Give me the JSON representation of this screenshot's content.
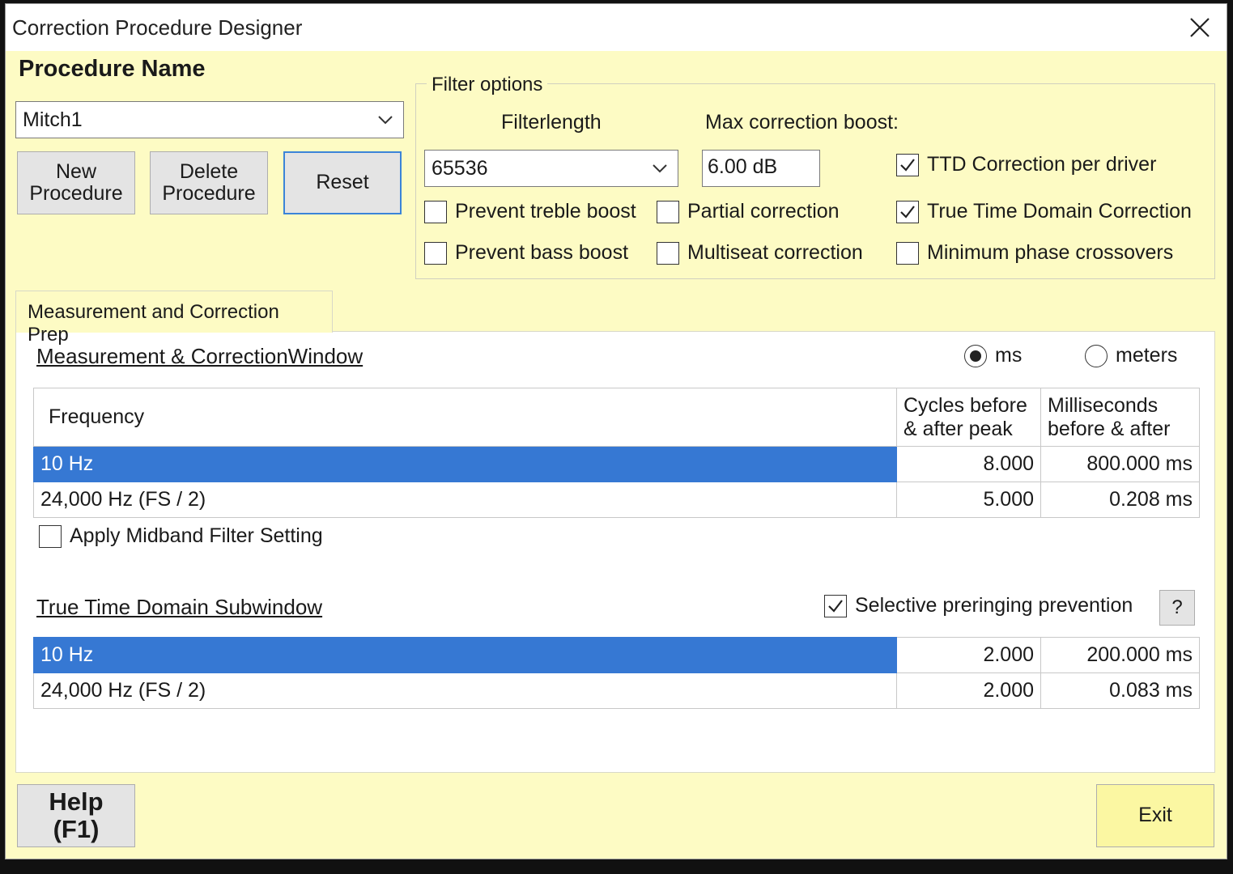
{
  "window": {
    "title": "Correction Procedure Designer",
    "colors": {
      "background": "#fdfbc4",
      "selection": "#3678d3",
      "focus_border": "#3b84d8"
    }
  },
  "procedure": {
    "label": "Procedure Name",
    "selected": "Mitch1",
    "buttons": {
      "new": "New Procedure",
      "delete": "Delete Procedure",
      "reset": "Reset"
    }
  },
  "filter_options": {
    "legend": "Filter options",
    "filterlength_label": "Filterlength",
    "filterlength_value": "65536",
    "max_boost_label": "Max correction boost:",
    "max_boost_value": "6.00 dB",
    "checkboxes": {
      "ttd_per_driver": {
        "label": "TTD Correction per driver",
        "checked": true
      },
      "prevent_treble": {
        "label": "Prevent treble boost",
        "checked": false
      },
      "partial": {
        "label": "Partial correction",
        "checked": false
      },
      "true_time_domain": {
        "label": "True Time Domain Correction",
        "checked": true
      },
      "prevent_bass": {
        "label": "Prevent bass boost",
        "checked": false
      },
      "multiseat": {
        "label": "Multiseat correction",
        "checked": false
      },
      "min_phase": {
        "label": "Minimum phase crossovers",
        "checked": false
      }
    }
  },
  "tab": {
    "label": "Measurement and Correction Prep"
  },
  "measurement_window": {
    "title": "Measurement & CorrectionWindow",
    "units": {
      "ms": "ms",
      "meters": "meters",
      "selected": "ms"
    },
    "columns": {
      "frequency": "Frequency",
      "cycles": "Cycles before & after peak",
      "ms": "Milliseconds before & after"
    },
    "rows": [
      {
        "freq": "10 Hz",
        "cycles": "8.000",
        "ms": "800.000 ms",
        "selected": true
      },
      {
        "freq": "24,000 Hz (FS / 2)",
        "cycles": "5.000",
        "ms": "0.208 ms",
        "selected": false
      }
    ],
    "midband": {
      "label": "Apply Midband Filter Setting",
      "checked": false
    }
  },
  "ttd_subwindow": {
    "title": "True Time Domain Subwindow",
    "selective_preringing": {
      "label": "Selective preringing prevention",
      "checked": true
    },
    "help_label": "?",
    "rows": [
      {
        "freq": "10 Hz",
        "cycles": "2.000",
        "ms": "200.000 ms",
        "selected": true
      },
      {
        "freq": "24,000 Hz (FS / 2)",
        "cycles": "2.000",
        "ms": "0.083 ms",
        "selected": false
      }
    ]
  },
  "footer": {
    "help_line1": "Help",
    "help_line2": "(F1)",
    "exit": "Exit"
  }
}
